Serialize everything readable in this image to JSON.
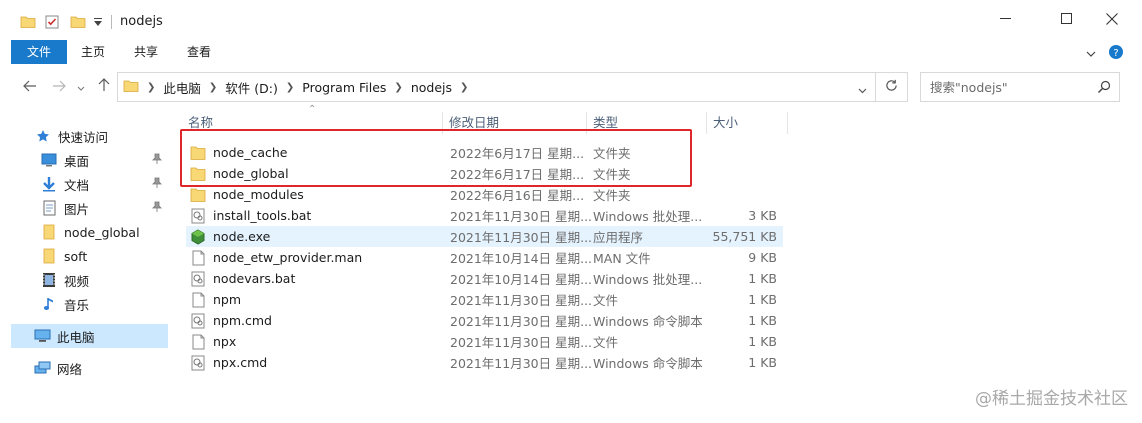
{
  "window": {
    "title": "nodejs",
    "minimize_icon": "minimize-icon",
    "maximize_icon": "maximize-icon",
    "close_icon": "close-icon"
  },
  "ribbon": {
    "tabs": [
      {
        "label": "文件"
      },
      {
        "label": "主页"
      },
      {
        "label": "共享"
      },
      {
        "label": "查看"
      }
    ]
  },
  "address": {
    "path": [
      "此电脑",
      "软件 (D:)",
      "Program Files",
      "nodejs"
    ]
  },
  "search": {
    "placeholder": "搜索\"nodejs\""
  },
  "nav": {
    "quick_access": "快速访问",
    "items": [
      {
        "label": "桌面"
      },
      {
        "label": "文档"
      },
      {
        "label": "图片"
      },
      {
        "label": "node_global"
      },
      {
        "label": "soft"
      },
      {
        "label": "视频"
      },
      {
        "label": "音乐"
      }
    ],
    "this_pc": "此电脑",
    "network": "网络"
  },
  "columns": {
    "name": "名称",
    "date": "修改日期",
    "type": "类型",
    "size": "大小"
  },
  "files": [
    {
      "name": "node_cache",
      "date": "2022年6月17日 星期...",
      "type": "文件夹",
      "size": "",
      "icon": "folder-icon"
    },
    {
      "name": "node_global",
      "date": "2022年6月17日 星期...",
      "type": "文件夹",
      "size": "",
      "icon": "folder-icon"
    },
    {
      "name": "node_modules",
      "date": "2022年6月16日 星期...",
      "type": "文件夹",
      "size": "",
      "icon": "folder-icon"
    },
    {
      "name": "install_tools.bat",
      "date": "2021年11月30日 星期...",
      "type": "Windows 批处理...",
      "size": "3 KB",
      "icon": "batch-file-icon"
    },
    {
      "name": "node.exe",
      "date": "2021年11月30日 星期...",
      "type": "应用程序",
      "size": "55,751 KB",
      "icon": "node-exe-icon"
    },
    {
      "name": "node_etw_provider.man",
      "date": "2021年10月14日 星期...",
      "type": "MAN 文件",
      "size": "9 KB",
      "icon": "file-icon"
    },
    {
      "name": "nodevars.bat",
      "date": "2021年10月14日 星期...",
      "type": "Windows 批处理...",
      "size": "1 KB",
      "icon": "batch-file-icon"
    },
    {
      "name": "npm",
      "date": "2021年11月30日 星期...",
      "type": "文件",
      "size": "1 KB",
      "icon": "file-icon"
    },
    {
      "name": "npm.cmd",
      "date": "2021年11月30日 星期...",
      "type": "Windows 命令脚本",
      "size": "1 KB",
      "icon": "batch-file-icon"
    },
    {
      "name": "npx",
      "date": "2021年11月30日 星期...",
      "type": "文件",
      "size": "1 KB",
      "icon": "file-icon"
    },
    {
      "name": "npx.cmd",
      "date": "2021年11月30日 星期...",
      "type": "Windows 命令脚本",
      "size": "1 KB",
      "icon": "batch-file-icon"
    }
  ],
  "watermark": "@稀土掘金技术社区",
  "colors": {
    "accent": "#1979ca",
    "selection": "#cce8ff",
    "hover": "#e5f3ff",
    "folder": "#f8d775",
    "annotation": "#e0262b"
  }
}
